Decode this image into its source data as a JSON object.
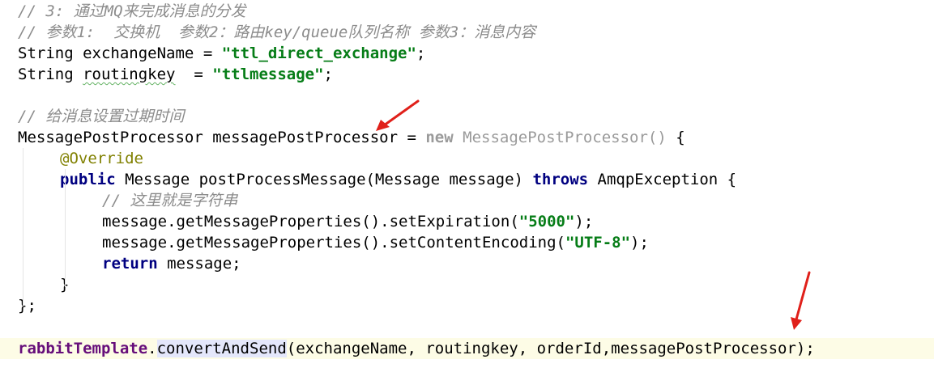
{
  "editor": {
    "comment1": "// 3: 通过MQ来完成消息的分发",
    "comment2": "// 参数1:  交换机  参数2：路由key/queue队列名称 参数3：消息内容",
    "decl_string": "String",
    "var_exchange": "exchangeName",
    "eq": " = ",
    "str_exchange": "\"ttl_direct_exchange\"",
    "semi": ";",
    "var_routing": "routingkey",
    "eq2": "  = ",
    "str_routing": "\"ttlmessage\"",
    "comment3": "// 给消息设置过期时间",
    "type_mpp": "MessagePostProcessor",
    "var_mpp": "messagePostProcessor",
    "kw_new": "new",
    "ctor_mpp": "MessagePostProcessor()",
    "brace_open": "{",
    "annotation": "@Override",
    "kw_public": "public",
    "method_sig": "Message postProcessMessage(Message message)",
    "kw_throws": "throws",
    "exception": "AmqpException {",
    "comment4": "// 这里就是字符串",
    "set_exp_pre": "message.getMessageProperties().setExpiration(",
    "str_5000": "\"5000\"",
    "close_paren": ");",
    "set_enc_pre": "message.getMessageProperties().setContentEncoding(",
    "str_utf8": "\"UTF-8\"",
    "kw_return": "return",
    "return_rest": "message;",
    "brace_close": "}",
    "anon_close": "};",
    "field_rabbit": "rabbitTemplate",
    "dot": ".",
    "method_send": "convertAndSend",
    "send_args": "(exchangeName, routingkey, orderId,messagePostProcessor);"
  },
  "colors": {
    "comment": "#8c8c8c",
    "keyword": "#000080",
    "string": "#067d17",
    "annotation": "#808000",
    "field": "#660e7a",
    "arrow": "#e0201a",
    "current_line": "#fdfce6",
    "identifier_highlight": "#e4e7fb"
  }
}
